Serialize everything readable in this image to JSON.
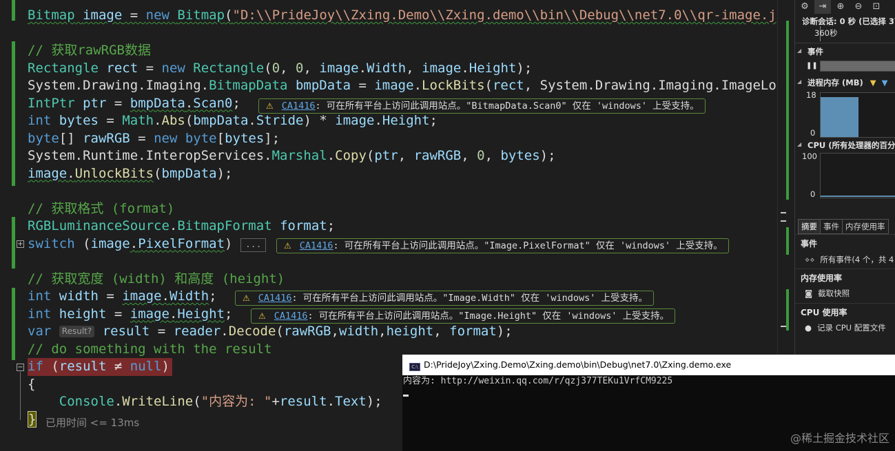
{
  "editor": {
    "lines": [
      {
        "id": "l1",
        "tokens": [
          [
            "ty",
            "Bitmap"
          ],
          [
            "pl",
            " "
          ],
          [
            "id",
            "image"
          ],
          [
            "pl",
            " = "
          ],
          [
            "kw",
            "new"
          ],
          [
            "pl",
            " "
          ],
          [
            "ty",
            "Bitmap"
          ],
          [
            "pl",
            "("
          ],
          [
            "st",
            "\"D:\\\\PrideJoy\\\\Zxing.Demo\\\\Zxing.demo\\\\bin\\\\Debug\\\\net7.0\\\\qr-image.j"
          ]
        ],
        "wavy": true
      },
      {
        "id": "l2",
        "tokens": []
      },
      {
        "id": "l3",
        "tokens": [
          [
            "cm",
            "// 获取rawRGB数据"
          ]
        ]
      },
      {
        "id": "l4",
        "tokens": [
          [
            "ty",
            "Rectangle"
          ],
          [
            "pl",
            " "
          ],
          [
            "id",
            "rect"
          ],
          [
            "pl",
            " = "
          ],
          [
            "kw",
            "new"
          ],
          [
            "pl",
            " "
          ],
          [
            "ty",
            "Rectangle"
          ],
          [
            "pl",
            "("
          ],
          [
            "nm",
            "0"
          ],
          [
            "pl",
            ", "
          ],
          [
            "nm",
            "0"
          ],
          [
            "pl",
            ", "
          ],
          [
            "id",
            "image"
          ],
          [
            "pl",
            "."
          ],
          [
            "id",
            "Width"
          ],
          [
            "pl",
            ", "
          ],
          [
            "id",
            "image"
          ],
          [
            "pl",
            "."
          ],
          [
            "id",
            "Height"
          ],
          [
            "pl",
            ");"
          ]
        ]
      },
      {
        "id": "l5",
        "tokens": [
          [
            "pl",
            "System."
          ],
          [
            "pl",
            "Drawing."
          ],
          [
            "pl",
            "Imaging."
          ],
          [
            "ty",
            "BitmapData"
          ],
          [
            "pl",
            " "
          ],
          [
            "id",
            "bmpData"
          ],
          [
            "pl",
            " = "
          ],
          [
            "id",
            "image"
          ],
          [
            "pl",
            "."
          ],
          [
            "mt",
            "LockBits"
          ],
          [
            "pl",
            "("
          ],
          [
            "id",
            "rect"
          ],
          [
            "pl",
            ", System.Drawing.Imaging.ImageLo"
          ]
        ]
      },
      {
        "id": "l6",
        "tokens": [
          [
            "ty",
            "IntPtr"
          ],
          [
            "pl",
            " "
          ],
          [
            "id",
            "ptr"
          ],
          [
            "pl",
            " = "
          ],
          [
            "id",
            "bmpData"
          ],
          [
            "pl",
            "."
          ],
          [
            "id",
            "Scan0"
          ],
          [
            "pl",
            ";"
          ]
        ]
      },
      {
        "id": "l7",
        "tokens": [
          [
            "kw",
            "int"
          ],
          [
            "pl",
            " "
          ],
          [
            "id",
            "bytes"
          ],
          [
            "pl",
            " = "
          ],
          [
            "ty",
            "Math"
          ],
          [
            "pl",
            "."
          ],
          [
            "mt",
            "Abs"
          ],
          [
            "pl",
            "("
          ],
          [
            "id",
            "bmpData"
          ],
          [
            "pl",
            "."
          ],
          [
            "id",
            "Stride"
          ],
          [
            "pl",
            ") * "
          ],
          [
            "id",
            "image"
          ],
          [
            "pl",
            "."
          ],
          [
            "id",
            "Height"
          ],
          [
            "pl",
            ";"
          ]
        ]
      },
      {
        "id": "l8",
        "tokens": [
          [
            "kw",
            "byte"
          ],
          [
            "pl",
            "[] "
          ],
          [
            "id",
            "rawRGB"
          ],
          [
            "pl",
            " = "
          ],
          [
            "kw",
            "new"
          ],
          [
            "pl",
            " "
          ],
          [
            "kw",
            "byte"
          ],
          [
            "pl",
            "["
          ],
          [
            "id",
            "bytes"
          ],
          [
            "pl",
            "];"
          ]
        ]
      },
      {
        "id": "l9",
        "tokens": [
          [
            "pl",
            "System.Runtime.InteropServices."
          ],
          [
            "ty",
            "Marshal"
          ],
          [
            "pl",
            "."
          ],
          [
            "mt",
            "Copy"
          ],
          [
            "pl",
            "("
          ],
          [
            "id",
            "ptr"
          ],
          [
            "pl",
            ", "
          ],
          [
            "id",
            "rawRGB"
          ],
          [
            "pl",
            ", "
          ],
          [
            "nm",
            "0"
          ],
          [
            "pl",
            ", "
          ],
          [
            "id",
            "bytes"
          ],
          [
            "pl",
            ");"
          ]
        ]
      },
      {
        "id": "l10",
        "tokens": [
          [
            "id",
            "image"
          ],
          [
            "pl",
            "."
          ],
          [
            "mt",
            "UnlockBits"
          ],
          [
            "pl",
            "("
          ],
          [
            "id",
            "bmpData"
          ],
          [
            "pl",
            ");"
          ]
        ]
      },
      {
        "id": "l11",
        "tokens": []
      },
      {
        "id": "l12",
        "tokens": [
          [
            "cm",
            "// 获取格式 (format)"
          ]
        ]
      },
      {
        "id": "l13",
        "tokens": [
          [
            "ty",
            "RGBLuminanceSource"
          ],
          [
            "pl",
            "."
          ],
          [
            "ty",
            "BitmapFormat"
          ],
          [
            "pl",
            " "
          ],
          [
            "id",
            "format"
          ],
          [
            "pl",
            ";"
          ]
        ]
      },
      {
        "id": "l14",
        "tokens": [
          [
            "kw",
            "switch"
          ],
          [
            "pl",
            " ("
          ],
          [
            "id",
            "image"
          ],
          [
            "pl",
            "."
          ],
          [
            "id",
            "PixelFormat"
          ],
          [
            "pl",
            ")"
          ]
        ],
        "ellipsis": "..."
      },
      {
        "id": "l15",
        "tokens": []
      },
      {
        "id": "l16",
        "tokens": [
          [
            "cm",
            "// 获取宽度 (width) 和高度 (height)"
          ]
        ]
      },
      {
        "id": "l17",
        "tokens": [
          [
            "kw",
            "int"
          ],
          [
            "pl",
            " "
          ],
          [
            "id",
            "width"
          ],
          [
            "pl",
            " = "
          ],
          [
            "id",
            "image"
          ],
          [
            "pl",
            "."
          ],
          [
            "id",
            "Width"
          ],
          [
            "pl",
            ";"
          ]
        ]
      },
      {
        "id": "l18",
        "tokens": [
          [
            "kw",
            "int"
          ],
          [
            "pl",
            " "
          ],
          [
            "id",
            "height"
          ],
          [
            "pl",
            " = "
          ],
          [
            "id",
            "image"
          ],
          [
            "pl",
            "."
          ],
          [
            "id",
            "Height"
          ],
          [
            "pl",
            ";"
          ]
        ]
      },
      {
        "id": "l19",
        "tokens": [
          [
            "kw",
            "var"
          ],
          [
            "pl",
            " "
          ],
          [
            "hint",
            "Result?"
          ],
          [
            "pl",
            " "
          ],
          [
            "id",
            "result"
          ],
          [
            "pl",
            " = "
          ],
          [
            "id",
            "reader"
          ],
          [
            "pl",
            "."
          ],
          [
            "mt",
            "Decode"
          ],
          [
            "pl",
            "("
          ],
          [
            "id",
            "rawRGB"
          ],
          [
            "pl",
            ","
          ],
          [
            "id",
            "width"
          ],
          [
            "pl",
            ","
          ],
          [
            "id",
            "height"
          ],
          [
            "pl",
            ", "
          ],
          [
            "id",
            "format"
          ],
          [
            "pl",
            ");"
          ]
        ]
      },
      {
        "id": "l20",
        "tokens": [
          [
            "cm",
            "// do something with the result"
          ]
        ]
      },
      {
        "id": "l21",
        "tokens": [
          [
            "kw",
            "if"
          ],
          [
            "pl",
            " ("
          ],
          [
            "id",
            "result"
          ],
          [
            "pl",
            " ≠ "
          ],
          [
            "kw",
            "null"
          ],
          [
            "pl",
            ")"
          ]
        ],
        "breakpoint": true
      },
      {
        "id": "l22",
        "tokens": [
          [
            "pl",
            "{"
          ]
        ]
      },
      {
        "id": "l23",
        "tokens": [
          [
            "pl",
            "    "
          ],
          [
            "ty",
            "Console"
          ],
          [
            "pl",
            "."
          ],
          [
            "mt",
            "WriteLine"
          ],
          [
            "pl",
            "("
          ],
          [
            "st",
            "\"内容为: \""
          ],
          [
            "pl",
            "+"
          ],
          [
            "id",
            "result"
          ],
          [
            "pl",
            "."
          ],
          [
            "id",
            "Text"
          ],
          [
            "pl",
            ");"
          ]
        ]
      },
      {
        "id": "l24",
        "tokens": [
          [
            "pl",
            "}"
          ]
        ],
        "brace": true
      }
    ],
    "diagnostics": [
      {
        "code": "CA1416",
        "message": ": 可在所有平台上访问此调用站点。\"BitmapData.Scan0\" 仅在 'windows' 上受支持。"
      },
      {
        "code": "CA1416",
        "message": ": 可在所有平台上访问此调用站点。\"Image.PixelFormat\" 仅在 'windows' 上受支持。"
      },
      {
        "code": "CA1416",
        "message": ": 可在所有平台上访问此调用站点。\"Image.Width\" 仅在 'windows' 上受支持。"
      },
      {
        "code": "CA1416",
        "message": ": 可在所有平台上访问此调用站点。\"Image.Height\" 仅在 'windows' 上受支持。"
      }
    ],
    "elapsed": "已用时间 <= 13ms"
  },
  "console": {
    "title": "D:\\PrideJoy\\Zxing.Demo\\Zxing.demo\\bin\\Debug\\net7.0\\Zxing.demo.exe",
    "output": "内容为: http://weixin.qq.com/r/qzj377TEKu1VrfCM9225",
    "watermark": "@稀土掘金技术社区",
    "icon": "console-icon"
  },
  "panel": {
    "session": "诊断会话: 0 秒 (已选择 37",
    "scale": "360秒",
    "events_label": "事件",
    "memory_label": "进程内存 (MB)",
    "memory_max": "18",
    "memory_min": "0",
    "cpu_label": "CPU (所有处理器的百分",
    "cpu_max": "100",
    "cpu_min": "0",
    "tabs": [
      "摘要",
      "事件",
      "内存使用率"
    ],
    "section_events": "事件",
    "all_events": "所有事件(4 个，共 4",
    "section_memory": "内存使用率",
    "snapshot": "截取快照",
    "section_cpu": "CPU 使用率",
    "record_cpu": "记录 CPU 配置文件",
    "accent_colors": {
      "gc": "#e8c547",
      "snapshot": "#5fa8e8",
      "bar": "#3c9b3c"
    },
    "memory_level": 0.9
  }
}
